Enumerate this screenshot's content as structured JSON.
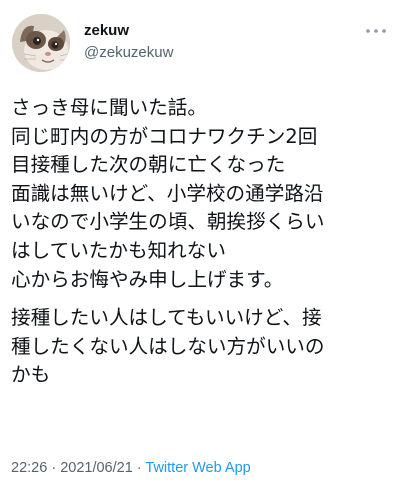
{
  "user": {
    "display_name": "zekuw",
    "handle": "@zekuzekuw"
  },
  "tweet": {
    "paragraphs": [
      "さっき母に聞いた話。\n同じ町内の方がコロナワクチン2回\n目接種した次の朝に亡くなった\n面識は無いけど、小学校の通学路沿\nいなので小学生の頃、朝挨拶くらい\nはしていたかも知れない\n心からお悔やみ申し上げます。",
      "接種したい人はしてもいいけど、接\n種したくない人はしない方がいいの\nかも"
    ],
    "time": "22:26",
    "separator_1": " · ",
    "date": "2021/06/21",
    "separator_2": " · ",
    "source": "Twitter Web App"
  },
  "icons": {
    "more": "more-horizontal-icon",
    "avatar": "cat-avatar-image"
  },
  "colors": {
    "text_primary": "#0f1419",
    "text_secondary": "#536471",
    "link": "#1d9bf0"
  }
}
